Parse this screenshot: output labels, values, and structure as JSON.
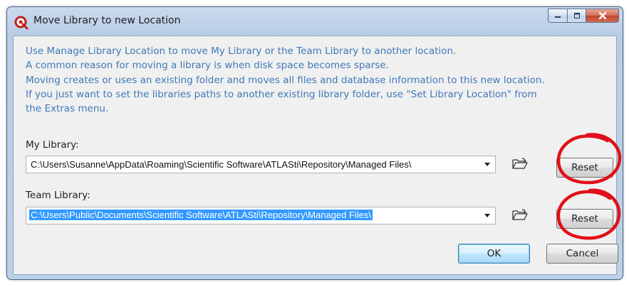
{
  "window": {
    "title": "Move Library to new Location"
  },
  "info_lines": [
    "Use Manage Library Location to move My Library or the Team Library to another location.",
    "A common reason for moving a library is when disk space becomes sparse.",
    "Moving creates or uses an existing folder and moves all files and database information to this new location.",
    "If you just want to set the libraries paths to another existing library folder, use \"Set Library Location\" from",
    "the Extras menu."
  ],
  "my_library": {
    "label": "My Library:",
    "path": "C:\\Users\\Susanne\\AppData\\Roaming\\Scientific Software\\ATLASti\\Repository\\Managed Files\\",
    "reset_label": "Reset"
  },
  "team_library": {
    "label": "Team Library:",
    "path": "C:\\Users\\Public\\Documents\\Scientific Software\\ATLASti\\Repository\\Managed Files\\",
    "reset_label": "Reset"
  },
  "buttons": {
    "ok": "OK",
    "cancel": "Cancel"
  },
  "icons": {
    "app": "atlasti-app-icon",
    "folder": "folder-open-icon",
    "minimize": "minimize-icon",
    "maximize": "maximize-icon",
    "close": "close-icon"
  },
  "colors": {
    "info_text": "#3f78b8",
    "selection": "#3399ff",
    "annotation": "#e0101a",
    "close_button": "#c1432d"
  }
}
